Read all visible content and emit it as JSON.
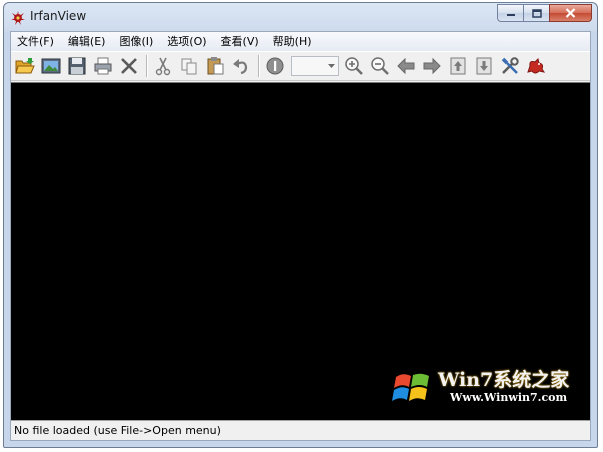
{
  "window": {
    "title": "IrfanView"
  },
  "menu": {
    "items": [
      "文件(F)",
      "编辑(E)",
      "图像(I)",
      "选项(O)",
      "查看(V)",
      "帮助(H)"
    ]
  },
  "toolbar": {
    "buttons": [
      "open-folder-icon",
      "slideshow-icon",
      "save-icon",
      "print-icon",
      "delete-icon",
      "cut-icon",
      "copy-icon",
      "paste-icon",
      "undo-icon",
      "info-icon",
      "zoom-combo",
      "zoom-in-icon",
      "zoom-out-icon",
      "previous-icon",
      "next-icon",
      "first-page-icon",
      "last-page-icon",
      "properties-icon",
      "about-icon"
    ],
    "zoom_value": ""
  },
  "status": {
    "text": "No file loaded (use File->Open menu)"
  },
  "watermark": {
    "title": "Win7系统之家",
    "url": "Www.Winwin7.com"
  },
  "colors": {
    "canvas": "#000000",
    "frame": "#cfdcee",
    "close_button": "#c44a33"
  }
}
